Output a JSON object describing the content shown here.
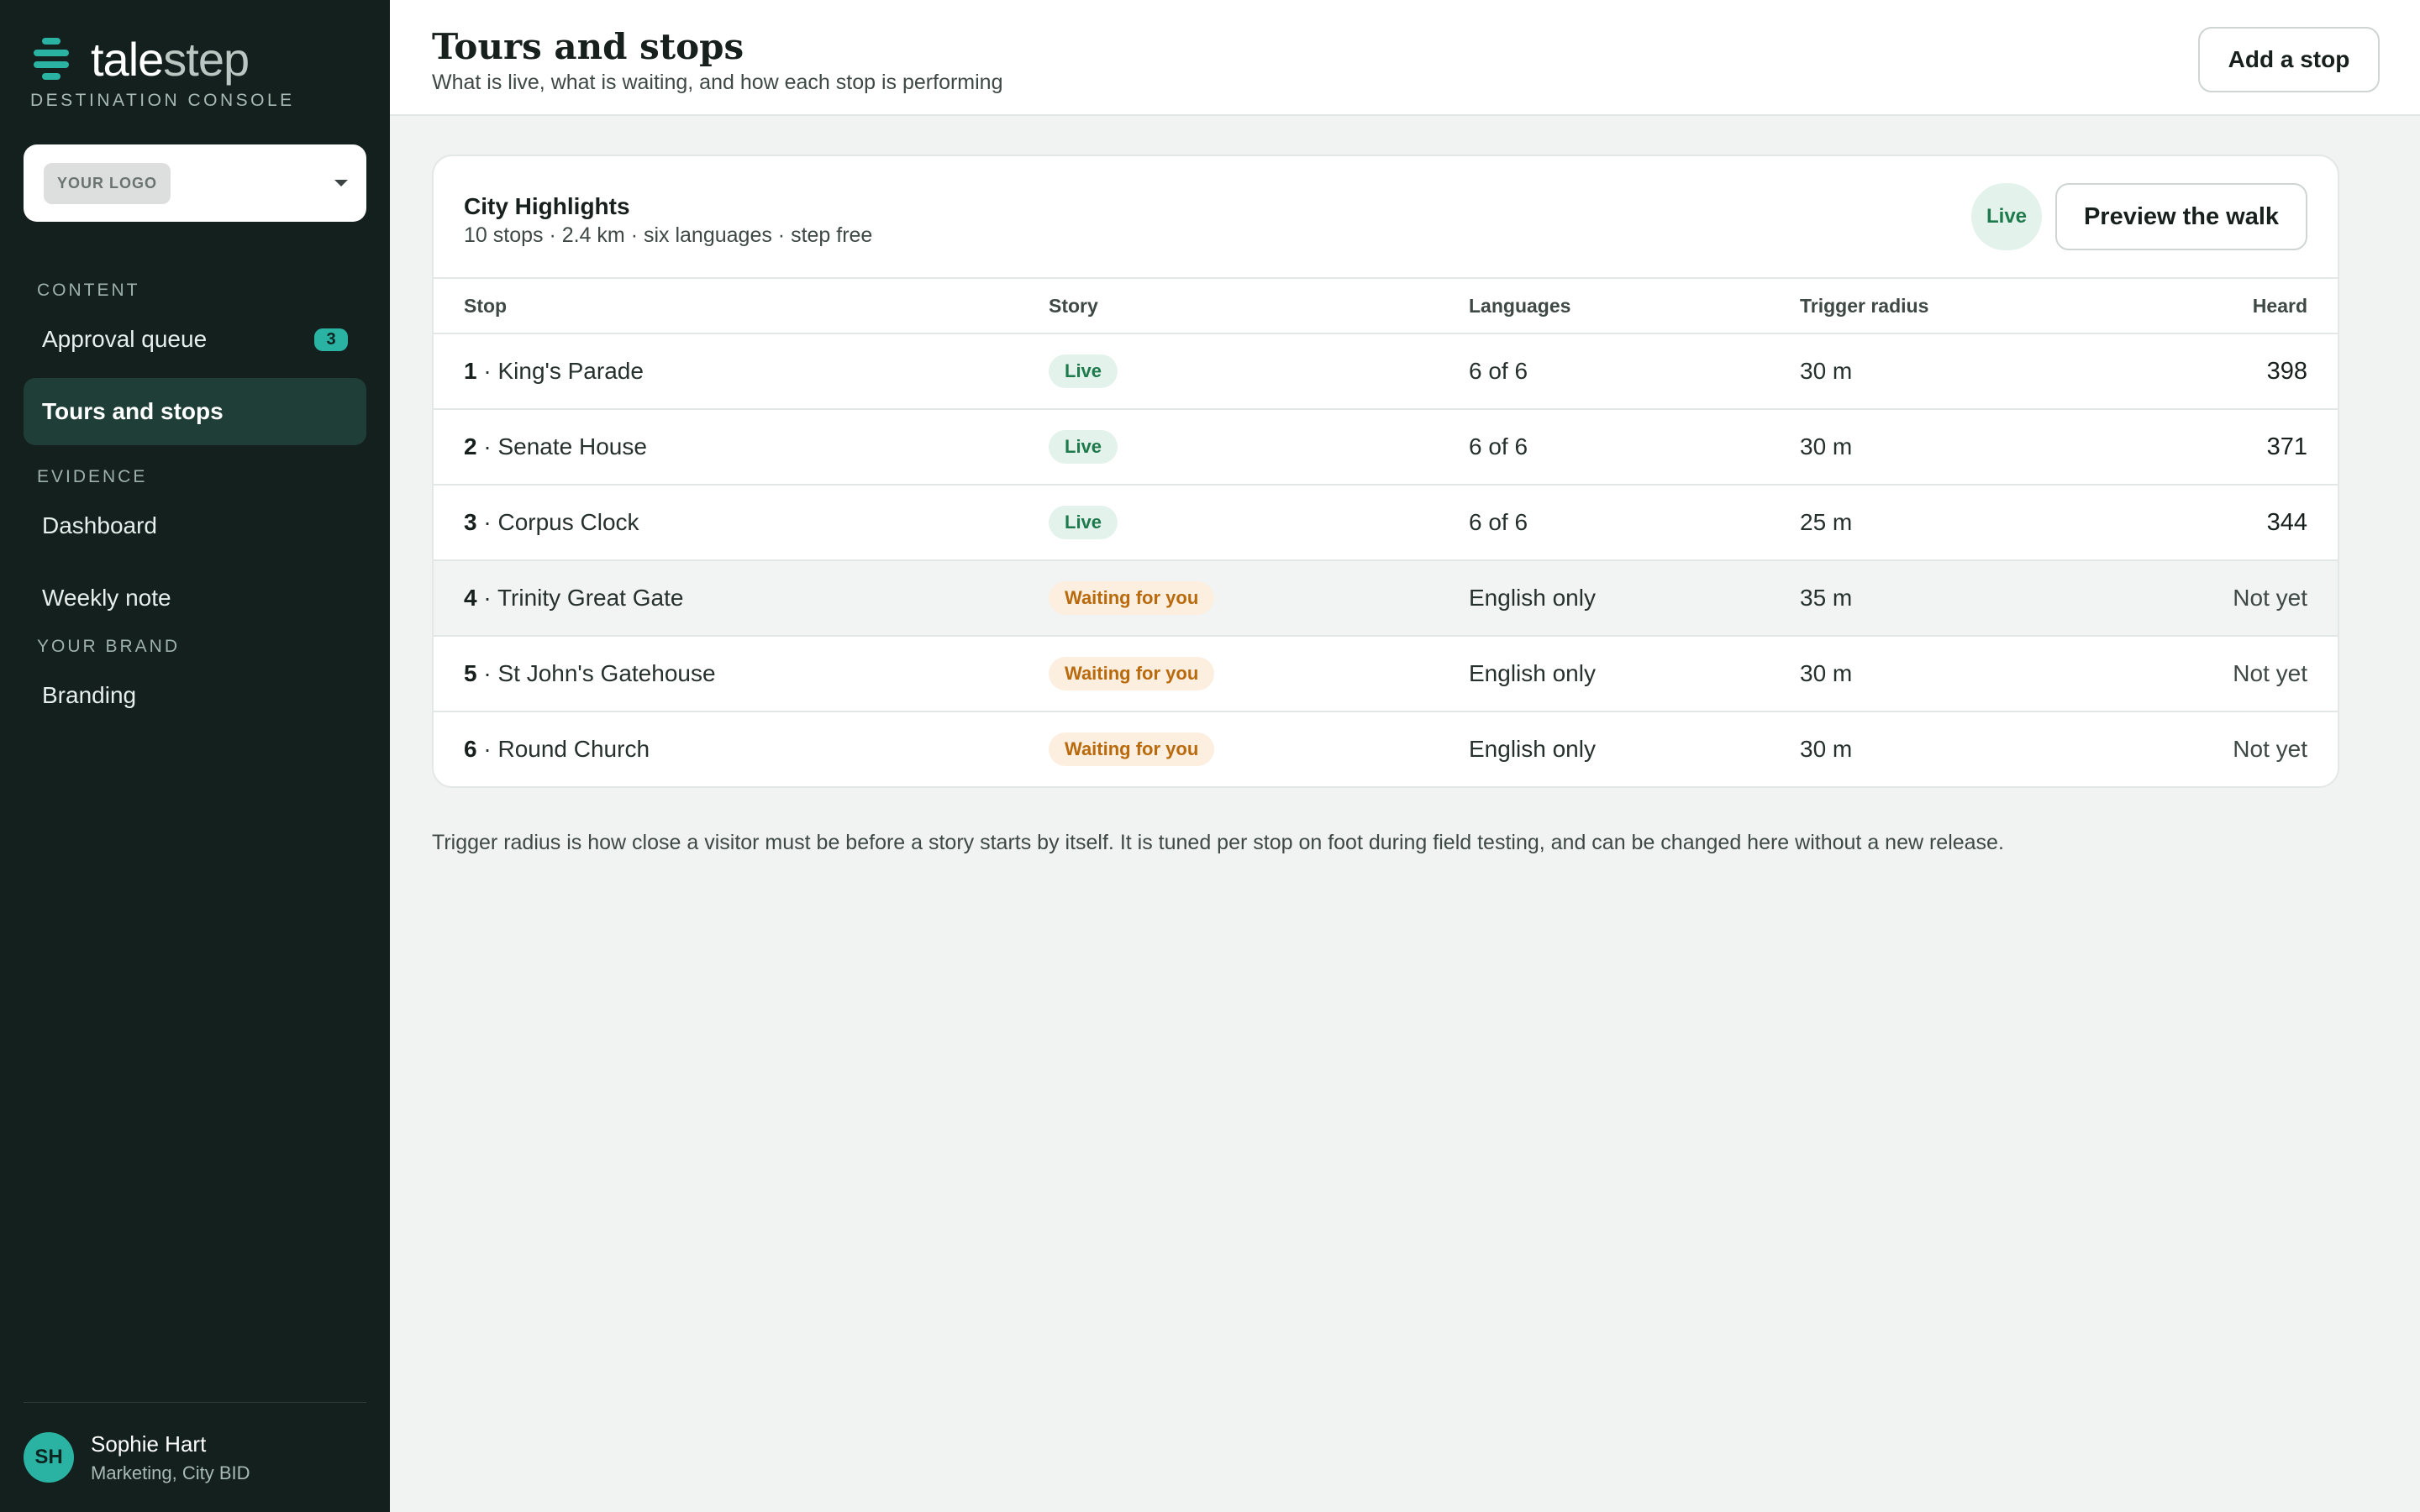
{
  "brand": {
    "name_part1": "tale",
    "name_part2": "step",
    "subtitle": "DESTINATION CONSOLE"
  },
  "logo_picker": {
    "label": "YOUR LOGO"
  },
  "sidebar": {
    "sections": [
      {
        "title": "CONTENT",
        "items": [
          {
            "label": "Approval queue",
            "badge": "3",
            "active": false
          },
          {
            "label": "Tours and stops",
            "active": true
          }
        ]
      },
      {
        "title": "EVIDENCE",
        "items": [
          {
            "label": "Dashboard",
            "active": false
          },
          {
            "label": "Weekly note",
            "active": false
          }
        ]
      },
      {
        "title": "YOUR BRAND",
        "items": [
          {
            "label": "Branding",
            "active": false
          }
        ]
      }
    ],
    "user": {
      "initials": "SH",
      "name": "Sophie Hart",
      "role": "Marketing, City BID"
    }
  },
  "header": {
    "title": "Tours and stops",
    "subtitle": "What is live, what is waiting, and how each stop is performing",
    "add_button": "Add a stop"
  },
  "tour": {
    "name": "City Highlights",
    "meta": "10 stops · 2.4 km · six languages · step free",
    "status": "Live",
    "preview_button": "Preview the walk",
    "columns": [
      "Stop",
      "Story",
      "Languages",
      "Trigger radius",
      "Heard"
    ],
    "rows": [
      {
        "num": "1",
        "name": "King's Parade",
        "story": "Live",
        "languages": "6 of 6",
        "radius": "30 m",
        "heard": "398"
      },
      {
        "num": "2",
        "name": "Senate House",
        "story": "Live",
        "languages": "6 of 6",
        "radius": "30 m",
        "heard": "371"
      },
      {
        "num": "3",
        "name": "Corpus Clock",
        "story": "Live",
        "languages": "6 of 6",
        "radius": "25 m",
        "heard": "344"
      },
      {
        "num": "4",
        "name": "Trinity Great Gate",
        "story": "Waiting for you",
        "languages": "English only",
        "radius": "35 m",
        "heard": "Not yet"
      },
      {
        "num": "5",
        "name": "St John's Gatehouse",
        "story": "Waiting for you",
        "languages": "English only",
        "radius": "30 m",
        "heard": "Not yet"
      },
      {
        "num": "6",
        "name": "Round Church",
        "story": "Waiting for you",
        "languages": "English only",
        "radius": "30 m",
        "heard": "Not yet"
      }
    ]
  },
  "footnote": "Trigger radius is how close a visitor must be before a story starts by itself. It is tuned per stop on foot during field testing, and can be changed here without a new release.",
  "colors": {
    "accent": "#2ab3a3",
    "sidebar_bg": "#13201d",
    "live": "#1e7a4c",
    "waiting": "#b86a0c"
  }
}
